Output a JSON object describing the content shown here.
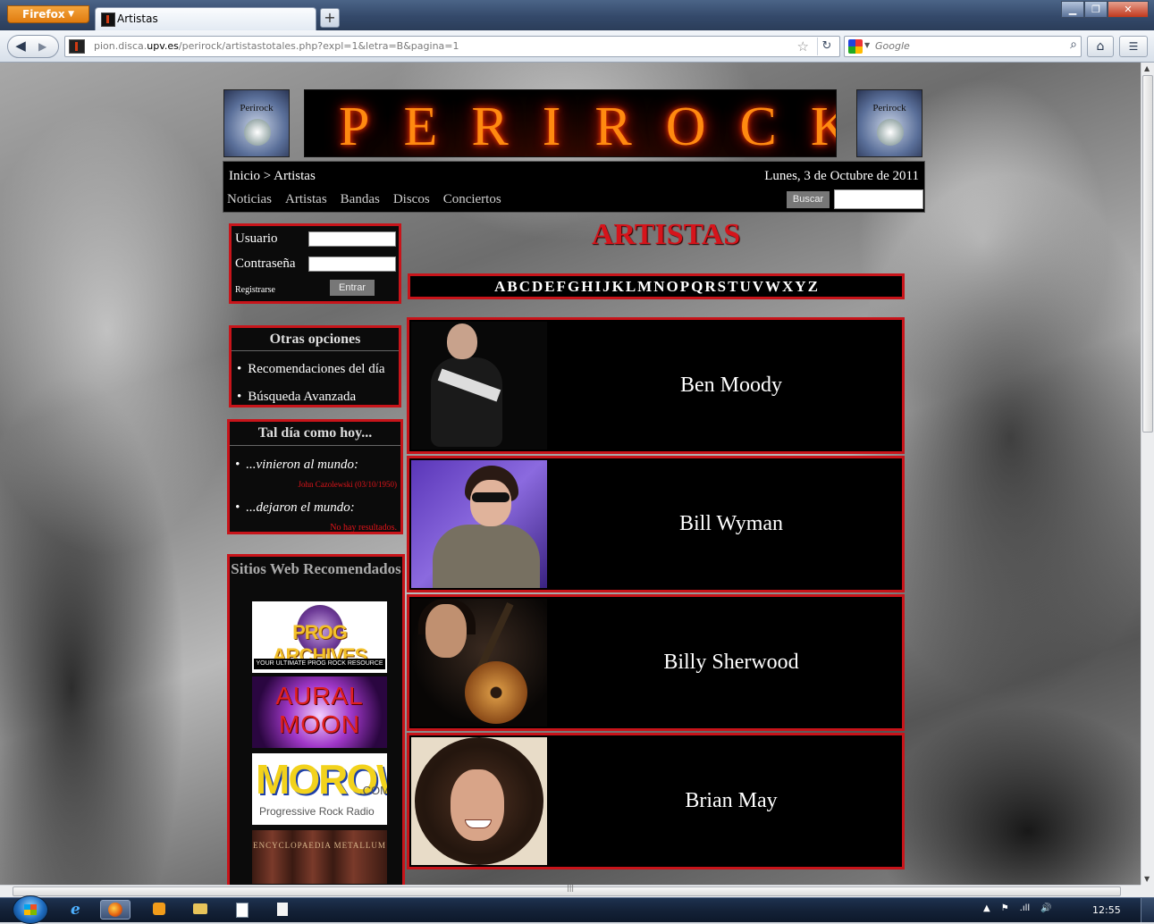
{
  "browser": {
    "menu_label": "Firefox",
    "tab_title": "Artistas",
    "new_tab": "+",
    "url_prefix": "pion.disca.",
    "url_domain": "upv.es",
    "url_path": "/perirock/artistastotales.php?expl=1&letra=B&pagina=1",
    "search_placeholder": "Google"
  },
  "site": {
    "logo_text": "Perirock",
    "banner": "PERIROCK",
    "breadcrumb": "Inicio > Artistas",
    "date": "Lunes, 3 de Octubre de 2011",
    "nav": [
      "Noticias",
      "Artistas",
      "Bandas",
      "Discos",
      "Conciertos"
    ],
    "search_button": "Buscar"
  },
  "login": {
    "user_label": "Usuario",
    "password_label": "Contraseña",
    "register": "Registrarse",
    "submit": "Entrar"
  },
  "otras": {
    "title": "Otras opciones",
    "items": [
      "Recomendaciones del día",
      "Búsqueda Avanzada"
    ]
  },
  "taldia": {
    "title": "Tal día como hoy...",
    "born_label": "...vinieron al mundo:",
    "born_value": "John Cazolewski (03/10/1950)",
    "died_label": "...dejaron el mundo:",
    "died_value": "No hay resultados."
  },
  "sitios": {
    "title": "Sitios Web Recomendados",
    "ads": {
      "progarchives": "PROG ARCHIVES",
      "progarchives_sub": "YOUR ULTIMATE PROG ROCK RESOURCE",
      "auralmoon": "AURAL MOON",
      "morow": "MOROW",
      "morow_com": ".COM",
      "morow_sub": "Progressive Rock Radio",
      "metallum": "ENCYCLOPAEDIA METALLUM"
    }
  },
  "main": {
    "heading": "ARTISTAS",
    "letters": [
      "A",
      "B",
      "C",
      "D",
      "E",
      "F",
      "G",
      "H",
      "I",
      "J",
      "K",
      "L",
      "M",
      "N",
      "O",
      "P",
      "Q",
      "R",
      "S",
      "T",
      "U",
      "V",
      "W",
      "X",
      "Y",
      "Z"
    ],
    "artists": [
      "Ben Moody",
      "Bill Wyman",
      "Billy Sherwood",
      "Brian May"
    ]
  },
  "taskbar": {
    "clock": "12:55",
    "tray": [
      "▲",
      "⚑",
      ".ıll",
      "🔊"
    ]
  }
}
